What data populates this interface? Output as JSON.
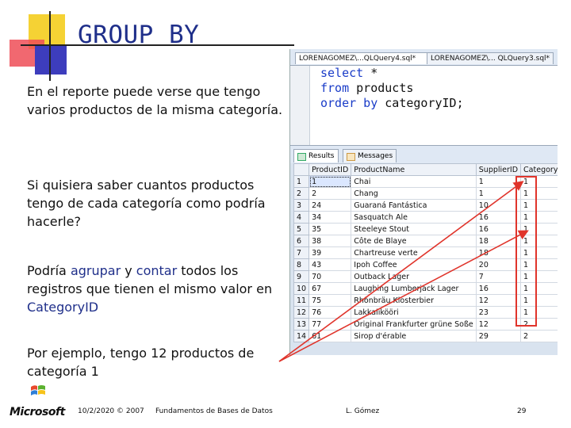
{
  "slide": {
    "title": "GROUP BY",
    "paragraphs": {
      "p1": "En el reporte puede verse que tengo varios productos de la misma categoría.",
      "p2": "Si quisiera saber cuantos productos tengo de cada categoría como podría hacerle?",
      "p3_a": "Podría ",
      "p3_b": "agrupar",
      "p3_c": " y ",
      "p3_d": "contar",
      "p3_e": "  todos los registros que tienen el mismo valor en ",
      "p3_f": "CategoryID",
      "p4": "Por ejemplo, tengo 12 productos de categoría 1"
    },
    "colors": {
      "title": "#1f2f8a",
      "highlight": "#1f2f8a",
      "red_box": "#e0342b"
    }
  },
  "screenshot": {
    "tabs": [
      "LORENAGOMEZ\\...QLQuery4.sql*",
      "LORENAGOMEZ\\... QLQuery3.sql*"
    ],
    "code": {
      "l1_kw": "select",
      "l1_tx": " *",
      "l2_kw": "from",
      "l2_tx": " products",
      "l3_kw": "order by",
      "l3_tx": " categoryID;"
    },
    "result_tabs": {
      "results": "Results",
      "messages": "Messages"
    },
    "columns": [
      "",
      "ProductID",
      "ProductName",
      "SupplierID",
      "CategoryID"
    ],
    "rows": [
      [
        "1",
        "1",
        "Chai",
        "1",
        "1"
      ],
      [
        "2",
        "2",
        "Chang",
        "1",
        "1"
      ],
      [
        "3",
        "24",
        "Guaraná Fantástica",
        "10",
        "1"
      ],
      [
        "4",
        "34",
        "Sasquatch Ale",
        "16",
        "1"
      ],
      [
        "5",
        "35",
        "Steeleye Stout",
        "16",
        "1"
      ],
      [
        "6",
        "38",
        "Côte de Blaye",
        "18",
        "1"
      ],
      [
        "7",
        "39",
        "Chartreuse verte",
        "18",
        "1"
      ],
      [
        "8",
        "43",
        "Ipoh Coffee",
        "20",
        "1"
      ],
      [
        "9",
        "70",
        "Outback Lager",
        "7",
        "1"
      ],
      [
        "10",
        "67",
        "Laughing Lumberjack Lager",
        "16",
        "1"
      ],
      [
        "11",
        "75",
        "Rhönbräu Klosterbier",
        "12",
        "1"
      ],
      [
        "12",
        "76",
        "Lakkalikööri",
        "23",
        "1"
      ],
      [
        "13",
        "77",
        "Original Frankfurter grüne Soße",
        "12",
        "2"
      ],
      [
        "14",
        "61",
        "Sirop d'érable",
        "29",
        "2"
      ]
    ]
  },
  "footer": {
    "logo": "Microsoft",
    "date": "10/2/2020 © 2007",
    "course": "Fundamentos de Bases de Datos",
    "author": "L. Gómez",
    "page": "29"
  }
}
